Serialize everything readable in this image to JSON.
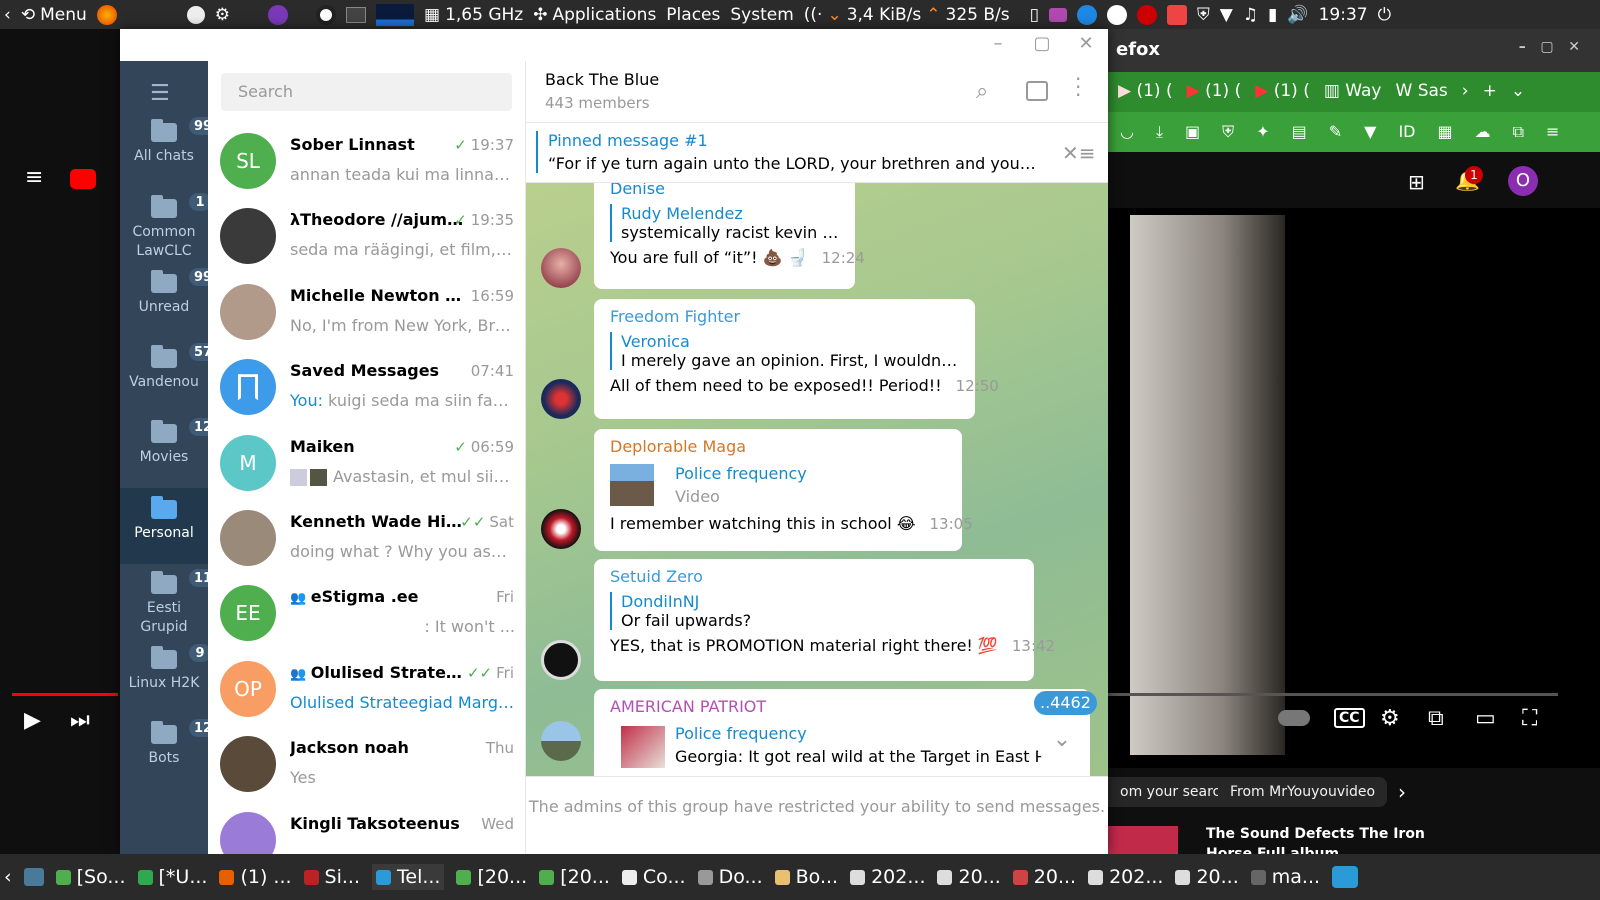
{
  "system_panel": {
    "menu_label": "Menu",
    "cpu_freq": "1,65 GHz",
    "applications": "Applications",
    "places": "Places",
    "system": "System",
    "net_down": "3,4 KiB/s",
    "net_up": "325 B/s",
    "clock": "19:37"
  },
  "background_firefox": {
    "title_fragment": "efox",
    "tabs": [
      "(1) (",
      "(1) (",
      "(1) (",
      "Way",
      "Sas"
    ],
    "video_controls": {
      "cc": "CC"
    },
    "chips": [
      "om your search",
      "From MrYouyouvideo"
    ],
    "suggestion_title": "The Sound Defects The Iron",
    "suggestion_sub": "Horse Full album",
    "notification_count": "1",
    "account_initial": "O"
  },
  "telegram": {
    "folders": [
      {
        "label": "All chats",
        "badge": "99+"
      },
      {
        "label": "CommonLawCLC",
        "badge": "1"
      },
      {
        "label": "Unread",
        "badge": "99+"
      },
      {
        "label": "Vandenou",
        "badge": "57"
      },
      {
        "label": "Movies",
        "badge": "12"
      },
      {
        "label": "Personal",
        "badge": ""
      },
      {
        "label": "Eesti Grupid",
        "badge": "11"
      },
      {
        "label": "Linux H2K",
        "badge": "9"
      },
      {
        "label": "Bots",
        "badge": "12"
      }
    ],
    "search_placeholder": "Search",
    "chats": [
      {
        "name": "Sober Linnast",
        "time": "19:37",
        "preview": "annan teada kui ma linnas, v...",
        "initials": "SL",
        "color": "#4fae4e",
        "read": "✓"
      },
      {
        "name": "λTheodore //ajum...",
        "time": "19:35",
        "preview": "seda ma räägingi, et film, esi...",
        "initials": "",
        "color": "#3a3a3a",
        "read": "✓"
      },
      {
        "name": "Michelle Newton @Mi...",
        "time": "16:59",
        "preview": "No, I'm from New York, Broo...",
        "initials": "",
        "color": "#b29a8a",
        "read": ""
      },
      {
        "name": "Saved Messages",
        "time": "07:41",
        "preview_prefix": "You:",
        "preview": " kuigi seda ma siin fants...",
        "initials": "",
        "color": "#3d9be9",
        "read": ""
      },
      {
        "name": "Maiken",
        "time": "06:59",
        "preview": "Avastasin, et mul siin f...",
        "initials": "M",
        "color": "#5bc7c7",
        "read": "✓"
      },
      {
        "name": "Kenneth Wade Hill's ...",
        "time": "Sat",
        "preview": "doing what ? Why you asking?",
        "initials": "",
        "color": "#9a8a7a",
        "read": "✓✓"
      },
      {
        "name": "eStigma .ee",
        "time": "Fri",
        "preview": ": It won't ...",
        "initials": "EE",
        "color": "#4fae4e",
        "read": ""
      },
      {
        "name": "Olulised Strateegi...",
        "time": "Fri",
        "preview": "Olulised Strateegiad Margus ...",
        "initials": "OP",
        "color": "#f89e64",
        "read": "✓✓"
      },
      {
        "name": "Jackson noah",
        "time": "Thu",
        "preview": "Yes",
        "initials": "",
        "color": "#5a4a3a",
        "read": ""
      },
      {
        "name": "Kingli Taksoteenus",
        "time": "Wed",
        "preview": "",
        "initials": "",
        "color": "#9b7bd8",
        "read": ""
      }
    ],
    "chat_header": {
      "title": "Back The Blue",
      "subtitle": "443 members"
    },
    "pinned": {
      "label": "Pinned message #1",
      "text": "“For if ye turn again unto the LORD, your brethren and your child..."
    },
    "messages": [
      {
        "sender": "Denise",
        "sender_color": "#168acd",
        "reply_name": "Rudy Melendez",
        "reply_text": "systemically racist kevin leo...",
        "text": "You are full of “it”! 💩 🚽",
        "time": "12:24"
      },
      {
        "sender": "Freedom Fighter",
        "sender_color": "#3a9ad8",
        "reply_name": "Veronica",
        "reply_text": "I merely gave an opinion. First, I wouldn't ha...",
        "text": "All of them need to be exposed!! Period!!",
        "time": "12:50"
      },
      {
        "sender": "Deplorable Maga",
        "sender_color": "#d27828",
        "reply_name": "Police frequency",
        "reply_text": "Video",
        "text": "I remember watching this in school 😂",
        "time": "13:05"
      },
      {
        "sender": "Setuid Zero",
        "sender_color": "#3a9ad8",
        "reply_name": "DondiInNJ",
        "reply_text": "Or fail upwards?",
        "text": "YES, that is PROMOTION material right there! 💯",
        "time": "13:42"
      },
      {
        "sender": "AMERICAN PATRIOT",
        "sender_color": "#b44fb4",
        "reply_name": "Police frequency",
        "reply_text": "Georgia: It got real wild at the Target in East Point ye...",
        "text": "",
        "time": ""
      }
    ],
    "unread_badge": "..4462",
    "footer_text": "The admins of this group have restricted your ability to send messages."
  },
  "taskbar": {
    "items": [
      "[So...",
      "[*U...",
      "(1) ...",
      "Si...",
      "Tel...",
      "[20...",
      "[20...",
      "Co...",
      "Do...",
      "Bo...",
      "202...",
      "20...",
      "20...",
      "202...",
      "20...",
      "ma..."
    ]
  }
}
